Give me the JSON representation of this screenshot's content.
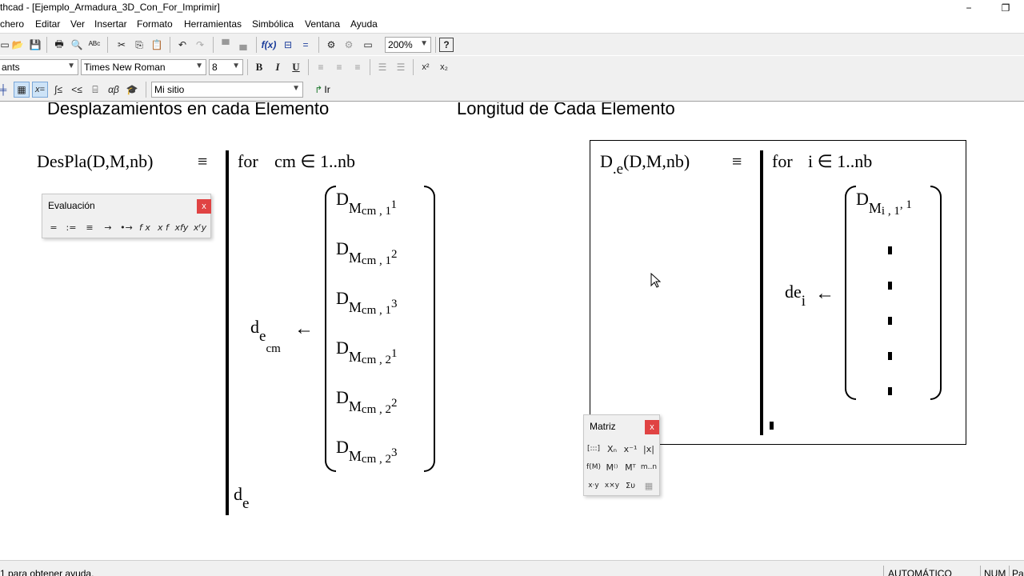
{
  "window": {
    "title": "thcad - [Ejemplo_Armadura_3D_Con_For_Imprimir]",
    "minimize": "−",
    "maximize": "❐"
  },
  "menu": [
    "chero",
    "Editar",
    "Ver",
    "Insertar",
    "Formato",
    "Herramientas",
    "Simbólica",
    "Ventana",
    "Ayuda"
  ],
  "toolbar": {
    "zoom": "200%",
    "style": "ants",
    "font": "Times New Roman",
    "size": "8",
    "bold": "B",
    "italic": "I",
    "underline": "U",
    "superscript": "x²",
    "subscript": "x₂",
    "resource": "Mi sitio",
    "go": "Ir",
    "help": "?"
  },
  "worksheet": {
    "heading_left": "Desplazamientos en cada Elemento",
    "heading_right": "Longitud de Cada Elemento",
    "left": {
      "lhs": "DesPla(D,M,nb)",
      "def": "≡",
      "for": "for",
      "for_var": "cm ∈ 1..nb",
      "assign_var": "d",
      "assign_sub_e": "e",
      "assign_sub_cm": "cm",
      "arrow": "←",
      "elements": [
        {
          "base": "D",
          "m": "M",
          "sub": "cm , 1",
          "idx": "1"
        },
        {
          "base": "D",
          "m": "M",
          "sub": "cm , 1",
          "idx": "2"
        },
        {
          "base": "D",
          "m": "M",
          "sub": "cm , 1",
          "idx": "3"
        },
        {
          "base": "D",
          "m": "M",
          "sub": "cm , 2",
          "idx": "1"
        },
        {
          "base": "D",
          "m": "M",
          "sub": "cm , 2",
          "idx": "2"
        },
        {
          "base": "D",
          "m": "M",
          "sub": "cm , 2",
          "idx": "3"
        }
      ],
      "return": "d",
      "return_sub": "e"
    },
    "right": {
      "lhs_d": "D",
      "lhs_sub": ".e",
      "lhs_args": "(D,M,nb)",
      "def": "≡",
      "for": "for",
      "for_var": "i ∈ 1..nb",
      "assign": "de",
      "assign_sub": "i",
      "arrow": "←",
      "first_base": "D",
      "first_m": "M",
      "first_sub": "i , 1",
      "first_idx": ", 1"
    }
  },
  "palettes": {
    "evaluacion": {
      "title": "Evaluación",
      "close": "x",
      "buttons": [
        "=",
        ":=",
        "≡",
        "→",
        "•→",
        "f x",
        "x f",
        "xfy",
        "xᶠy"
      ]
    },
    "matriz": {
      "title": "Matriz",
      "close": "x",
      "buttons": [
        "[:::]",
        "Xₙ",
        "x⁻¹",
        "|x|",
        "f(M)",
        "M⁽⁾",
        "Mᵀ",
        "m..n",
        "x·y",
        "x×y",
        "Συ",
        "▦"
      ]
    }
  },
  "status": {
    "help": "1 para obtener ayuda.",
    "mode": "AUTOMÁTICO",
    "num": "NUM",
    "page": "Pa"
  }
}
